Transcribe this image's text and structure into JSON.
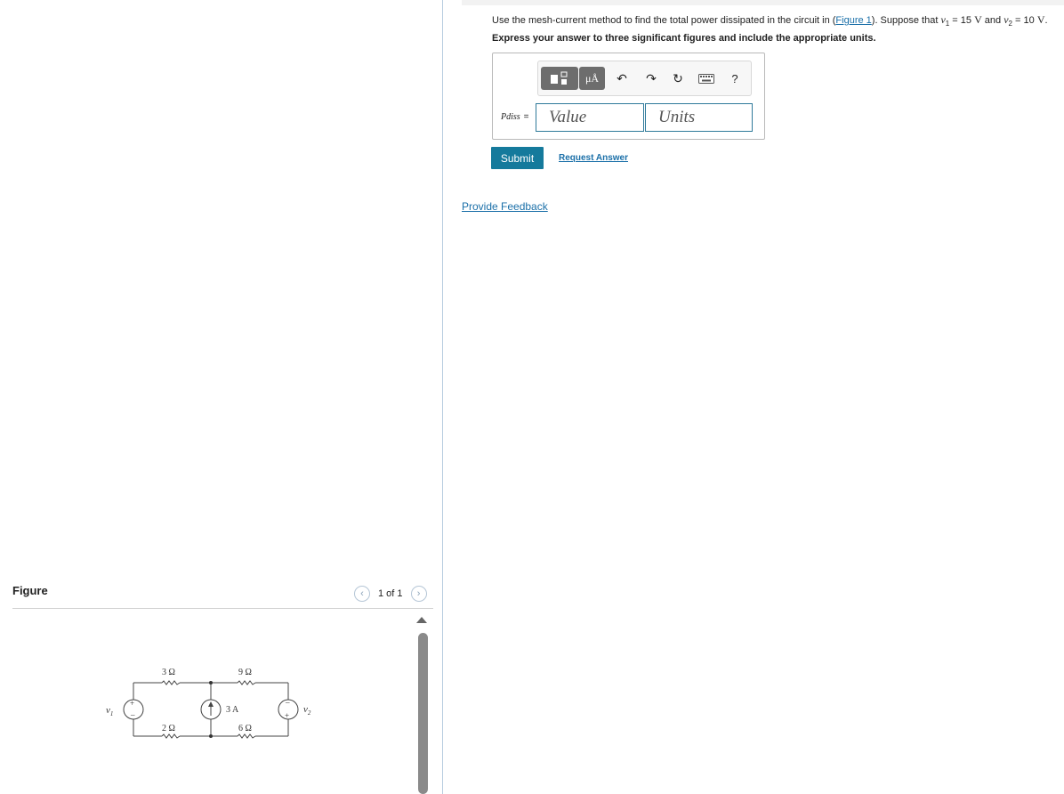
{
  "question": {
    "text_before": "Use the mesh-current method to find the total power dissipated in the circuit in (",
    "figure_link": "Figure 1",
    "text_mid": "). Suppose that ",
    "v1_var": "v",
    "v1_sub": "1",
    "v1_value": " = 15 ",
    "v1_unit": "V",
    "and_text": " and ",
    "v2_var": "v",
    "v2_sub": "2",
    "v2_value": " = 10 ",
    "v2_unit": "V",
    "end": "."
  },
  "instruction": "Express your answer to three significant figures and include the appropriate units.",
  "toolbar": {
    "units_label": "μÅ",
    "help_label": "?"
  },
  "answer": {
    "label": "Pdiss",
    "equals": "=",
    "value_placeholder": "Value",
    "units_placeholder": "Units"
  },
  "buttons": {
    "submit": "Submit",
    "request_answer": "Request Answer",
    "provide_feedback": "Provide Feedback"
  },
  "figure": {
    "heading": "Figure",
    "pager_text": "1 of 1",
    "circuit_labels": {
      "r_top_left": "3 Ω",
      "r_top_right": "9 Ω",
      "r_bottom_left": "2 Ω",
      "r_bottom_right": "6 Ω",
      "current_source": "3 A",
      "v1": "v",
      "v1_sub": "1",
      "v2": "v",
      "v2_sub": "2"
    }
  }
}
